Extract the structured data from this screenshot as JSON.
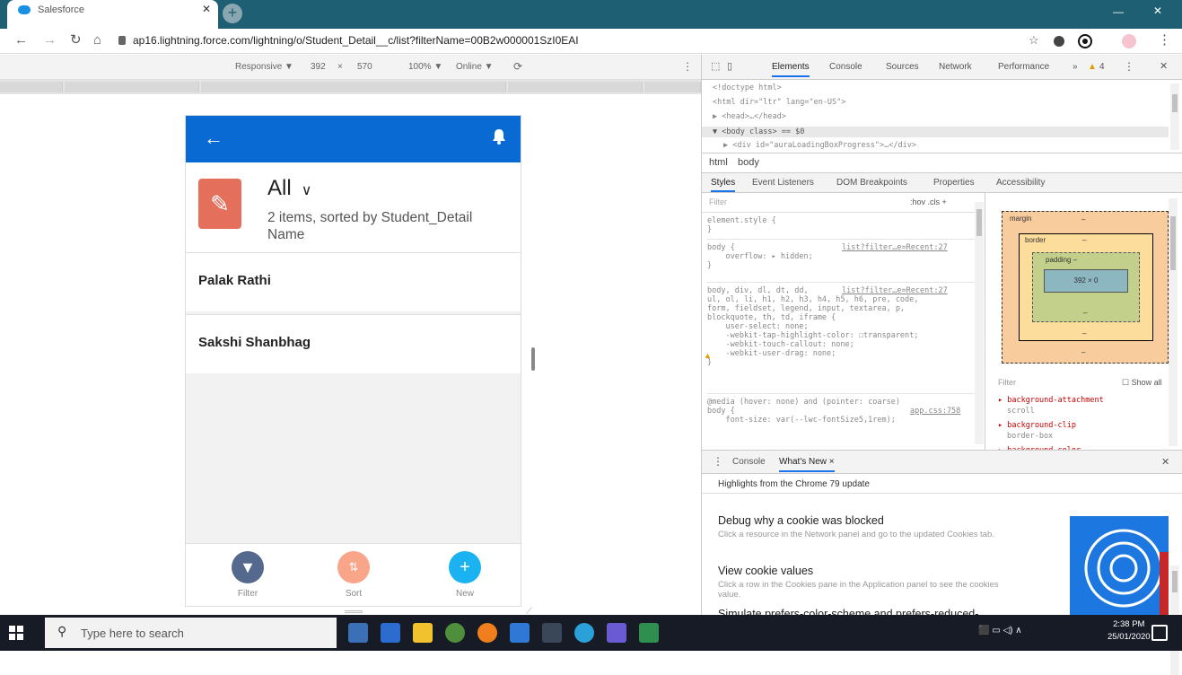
{
  "browser": {
    "tab_title": "Salesforce",
    "url": "ap16.lightning.force.com/lightning/o/Student_Detail__c/list?filterName=00B2w000001SzI0EAI"
  },
  "device_toolbar": {
    "device": "Responsive ▼",
    "width": "392",
    "times": "×",
    "height": "570",
    "zoom": "100% ▼",
    "network": "Online ▼"
  },
  "app": {
    "list_view": "All",
    "subtitle": "2 items, sorted by Student_Detail Name",
    "records": [
      "Palak Rathi",
      "Sakshi Shanbhag"
    ],
    "footer": {
      "filter_label": "Filter",
      "sort_label": "Sort",
      "new_label": "New"
    },
    "colors": {
      "header": "#0a6ad3",
      "list_icon": "#e4705c",
      "filter": "#54698d",
      "sort": "#f8a58a",
      "new": "#1ab2f0"
    }
  },
  "devtools": {
    "tabs": [
      "Elements",
      "Console",
      "Sources",
      "Network",
      "Performance",
      "»"
    ],
    "warnings": "4",
    "dom_lines": [
      "<!doctype html>",
      "<html dir=\"ltr\" lang=\"en-US\">",
      "▶ <head>…</head>",
      "▼ <body class> == $0",
      "▶ <div id=\"auraLoadingBoxProgress\">…</div>"
    ],
    "breadcrumbs": [
      "html",
      "body"
    ],
    "sub_tabs": [
      "Styles",
      "Event Listeners",
      "DOM Breakpoints",
      "Properties",
      "Accessibility"
    ],
    "filter_placeholder": "Filter",
    "filter_tools": ":hov  .cls  +",
    "style_rules": [
      {
        "code": "element.style {\n}",
        "source": ""
      },
      {
        "code": "body {\n    overflow: ▸ hidden;\n}",
        "source": "list?filter…e=Recent:27"
      },
      {
        "code": "body, div, dl, dt, dd, \nul, ol, li, h1, h2, h3, h4, h5, h6, pre, code,\nform, fieldset, legend, input, textarea, p,\nblockquote, th, td, iframe {\n    user-select: none;\n    -webkit-tap-highlight-color: ☐transparent;\n    -webkit-touch-callout: none;\n    -webkit-user-drag: none;\n}",
        "source": "list?filter…e=Recent:27"
      },
      {
        "code": "@media (hover: none) and (pointer: coarse)\nbody {\n    font-size: var(--lwc-fontSize5,1rem);",
        "source": "app.css:758"
      }
    ],
    "box_model": {
      "margin": "margin",
      "border": "border",
      "padding": "padding –",
      "content": "392 × 0",
      "dash": "–"
    },
    "computed_filter": "Filter",
    "show_all": "Show all",
    "computed": [
      "▸ background-attachment",
      "scroll",
      "▸ background-clip",
      "border-box",
      "▸ background-color"
    ],
    "drawer_tabs": [
      "Console",
      "What's New ×"
    ],
    "highlights": "Highlights from the Chrome 79 update",
    "whats_new": [
      {
        "title": "Debug why a cookie was blocked",
        "desc": "Click a resource in the Network panel and go to the updated Cookies tab."
      },
      {
        "title": "View cookie values",
        "desc": "Click a row in the Cookies pane in the Application panel to see the cookies value."
      },
      {
        "title": "Simulate prefers-color-scheme and prefers-reduced-",
        "desc": ""
      }
    ]
  },
  "taskbar": {
    "search_placeholder": "Type here to search",
    "time": "2:38 PM",
    "date": "25/01/2020"
  }
}
